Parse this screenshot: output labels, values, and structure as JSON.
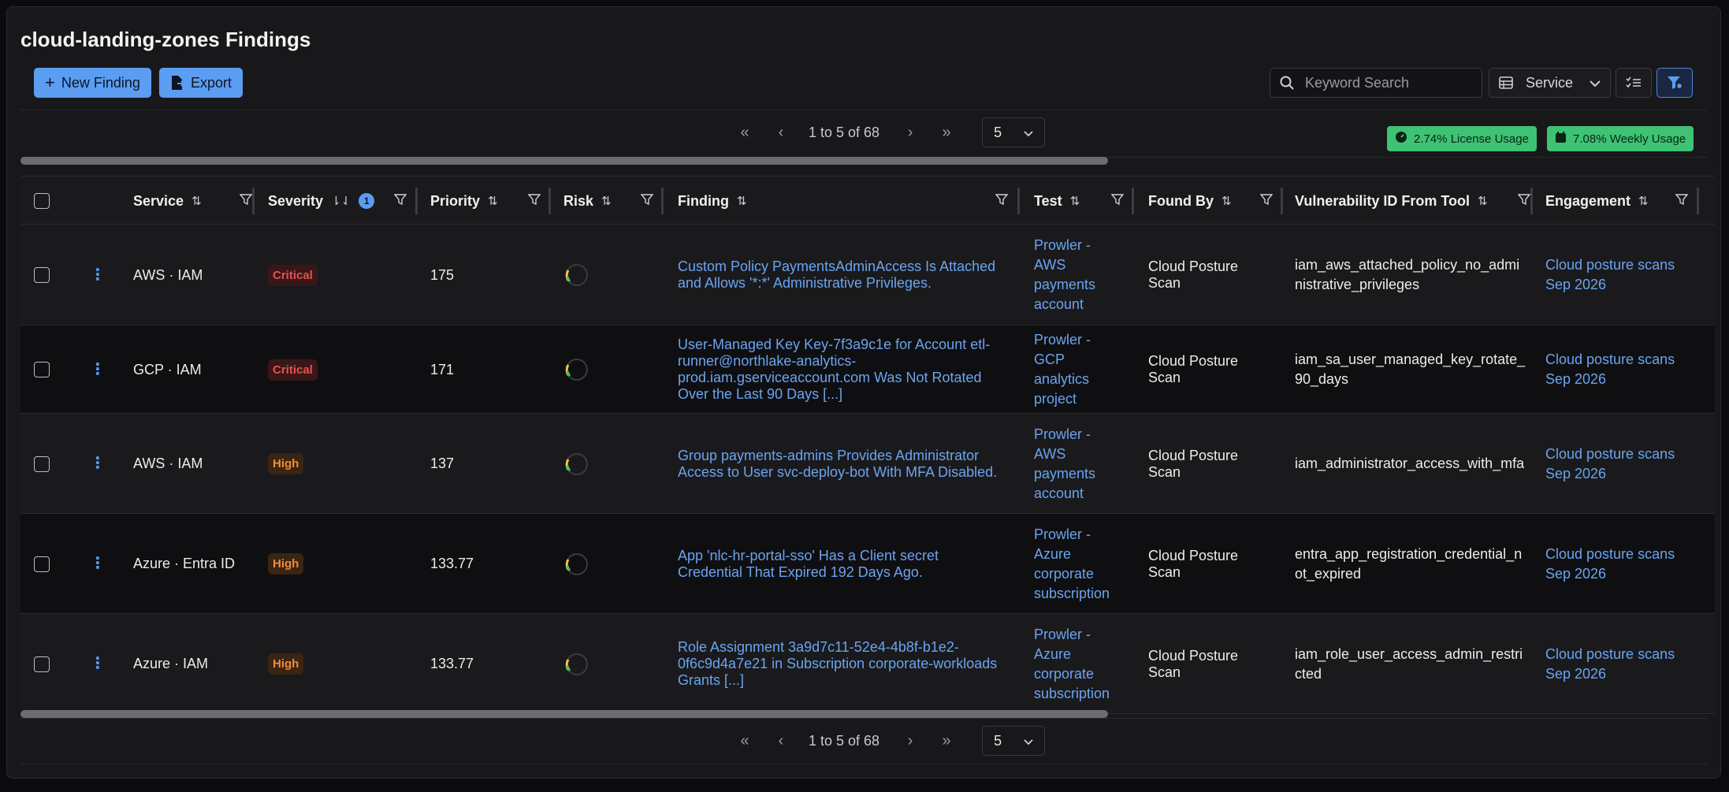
{
  "title": "cloud-landing-zones Findings",
  "toolbar": {
    "new_finding_label": "New Finding",
    "export_label": "Export",
    "search_placeholder": "Keyword Search",
    "service_select": "Service"
  },
  "pagination": {
    "first": "«",
    "prev": "‹",
    "range": "1 to 5 of 68",
    "next": "›",
    "last": "»",
    "page_size": "5"
  },
  "usage": {
    "license": "2.74% License Usage",
    "weekly": "7.08% Weekly Usage"
  },
  "columns": {
    "service": "Service",
    "severity": "Severity",
    "severity_badge": "1",
    "priority": "Priority",
    "risk": "Risk",
    "finding": "Finding",
    "test": "Test",
    "found_by": "Found By",
    "vuln_id": "Vulnerability ID From Tool",
    "engagement": "Engagement"
  },
  "rows": [
    {
      "service": "AWS · IAM",
      "severity": "Critical",
      "priority": "175",
      "finding": "Custom Policy PaymentsAdminAccess Is Attached and Allows '*:*' Administrative Privileges.",
      "test": "Prowler - AWS payments account",
      "found_by": "Cloud Posture Scan",
      "vuln_id": "iam_aws_attached_policy_no_administrative_privileges",
      "engagement": "Cloud posture scans Sep 2026"
    },
    {
      "service": "GCP · IAM",
      "severity": "Critical",
      "priority": "171",
      "finding": "User-Managed Key Key-7f3a9c1e for Account etl-runner@northlake-analytics-prod.iam.gserviceaccount.com Was Not Rotated Over the Last 90 Days [...]",
      "test": "Prowler - GCP analytics project",
      "found_by": "Cloud Posture Scan",
      "vuln_id": "iam_sa_user_managed_key_rotate_90_days",
      "engagement": "Cloud posture scans Sep 2026"
    },
    {
      "service": "AWS · IAM",
      "severity": "High",
      "priority": "137",
      "finding": "Group payments-admins Provides Administrator Access to User svc-deploy-bot With MFA Disabled.",
      "test": "Prowler - AWS payments account",
      "found_by": "Cloud Posture Scan",
      "vuln_id": "iam_administrator_access_with_mfa",
      "engagement": "Cloud posture scans Sep 2026"
    },
    {
      "service": "Azure · Entra ID",
      "severity": "High",
      "priority": "133.77",
      "finding": "App 'nlc-hr-portal-sso' Has a Client secret Credential That Expired 192 Days Ago.",
      "test": "Prowler - Azure corporate subscription",
      "found_by": "Cloud Posture Scan",
      "vuln_id": "entra_app_registration_credential_not_expired",
      "engagement": "Cloud posture scans Sep 2026"
    },
    {
      "service": "Azure · IAM",
      "severity": "High",
      "priority": "133.77",
      "finding": "Role Assignment 3a9d7c11-52e4-4b8f-b1e2-0f6c9d4a7e21 in Subscription corporate-workloads Grants [...]",
      "test": "Prowler - Azure corporate subscription",
      "found_by": "Cloud Posture Scan",
      "vuln_id": "iam_role_user_access_admin_restricted",
      "engagement": "Cloud posture scans Sep 2026"
    }
  ]
}
